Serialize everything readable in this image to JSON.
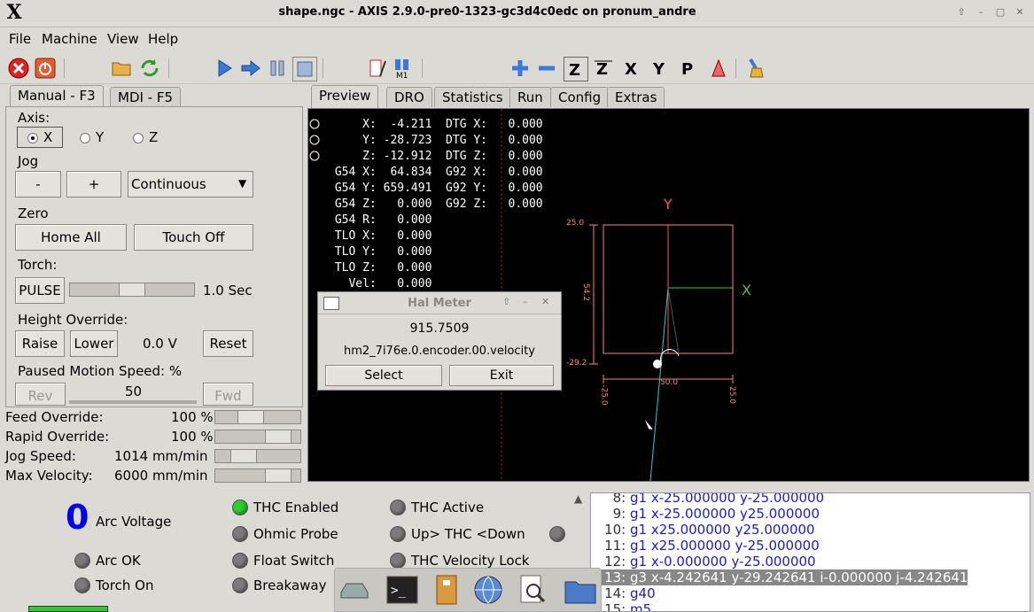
{
  "window": {
    "logo": "X",
    "title": "shape.ngc - AXIS 2.9.0-pre0-1323-gc3d4c0edc on pronum_andre",
    "controls": [
      "up-arrow-icon",
      "minimize-icon",
      "maximize-icon",
      "close-icon"
    ]
  },
  "menu": {
    "file": "File",
    "machine": "Machine",
    "view": "View",
    "help": "Help"
  },
  "toolbar": {
    "icons": [
      "estop-icon",
      "power-icon",
      "open-file-icon",
      "reload-icon",
      "run-icon",
      "step-icon",
      "pause-icon",
      "stop-icon",
      "block-delete-icon",
      "optional-stop-icon",
      "zoom-in-icon",
      "zoom-out-icon",
      "view-z-icon",
      "view-z2-icon",
      "view-x-icon",
      "view-y-icon",
      "view-p-icon",
      "rotate-view-icon",
      "clear-plot-icon"
    ]
  },
  "left_tabs": {
    "manual": "Manual - F3",
    "mdi": "MDI - F5"
  },
  "right_tabs": {
    "preview": "Preview",
    "dro": "DRO",
    "statistics": "Statistics",
    "run": "Run",
    "config": "Config",
    "extras": "Extras"
  },
  "manual": {
    "axis_label": "Axis:",
    "axes": [
      "X",
      "Y",
      "Z"
    ],
    "selected_axis": "X",
    "jog_label": "Jog",
    "jog_minus": "-",
    "jog_plus": "+",
    "jog_mode": "Continuous",
    "zero_label": "Zero",
    "home_all": "Home All",
    "touch_off": "Touch Off",
    "torch_label": "Torch:",
    "pulse": "PULSE",
    "pulse_time": "1.0 Sec",
    "pulse_level": 0.5,
    "height_override_label": "Height Override:",
    "raise": "Raise",
    "lower": "Lower",
    "height_value": "0.0 V",
    "reset": "Reset",
    "paused_speed_label": "Paused Motion Speed: %",
    "rev": "Rev",
    "paused_speed": "50",
    "fwd": "Fwd"
  },
  "overrides": {
    "feed_label": "Feed Override:",
    "feed_value": "100 %",
    "feed_level": 0.38,
    "rapid_label": "Rapid Override:",
    "rapid_value": "100 %",
    "rapid_level": 0.85,
    "jog_label": "Jog Speed:",
    "jog_value": "1014 mm/min",
    "jog_level": 0.25,
    "maxvel_label": "Max Velocity:",
    "maxvel_value": "6000 mm/min",
    "maxvel_level": 0.85
  },
  "dro": {
    "rows": [
      {
        "l": "     X:",
        "v": "  -4.211",
        "r": "DTG X:",
        "rv": "   0.000"
      },
      {
        "l": "     Y:",
        "v": " -28.723",
        "r": "DTG Y:",
        "rv": "   0.000"
      },
      {
        "l": "     Z:",
        "v": " -12.912",
        "r": "DTG Z:",
        "rv": "   0.000"
      },
      {
        "l": " G54 X:",
        "v": "  64.834",
        "r": "G92 X:",
        "rv": "   0.000"
      },
      {
        "l": " G54 Y:",
        "v": " 659.491",
        "r": "G92 Y:",
        "rv": "   0.000"
      },
      {
        "l": " G54 Z:",
        "v": "   0.000",
        "r": "G92 Z:",
        "rv": "   0.000"
      },
      {
        "l": " G54 R:",
        "v": "   0.000",
        "r": "",
        "rv": ""
      },
      {
        "l": " TLO X:",
        "v": "   0.000",
        "r": "",
        "rv": ""
      },
      {
        "l": " TLO Y:",
        "v": "   0.000",
        "r": "",
        "rv": ""
      },
      {
        "l": " TLO Z:",
        "v": "   0.000",
        "r": "",
        "rv": ""
      },
      {
        "l": "   Vel:",
        "v": "   0.000",
        "r": "",
        "rv": ""
      }
    ],
    "axis_y_label": "Y",
    "axis_x_label": "X",
    "dim_top": "25.0",
    "dim_left": "54.2",
    "dim_bottom_left": "-29.2",
    "dim_width": "50.0",
    "dim_x_min": "-25.0",
    "dim_x_max": "25.0"
  },
  "halmeter": {
    "title": "Hal Meter",
    "value": "915.7509",
    "pin": "hm2_7i76e.0.encoder.00.velocity",
    "select": "Select",
    "exit": "Exit"
  },
  "thc": {
    "arc_voltage_value": "0",
    "arc_voltage_label": "Arc Voltage",
    "arc_ok": "Arc OK",
    "torch_on": "Torch On",
    "thc_enabled": "THC Enabled",
    "ohmic_probe": "Ohmic Probe",
    "float_switch": "Float Switch",
    "breakaway": "Breakaway",
    "thc_active": "THC Active",
    "up_down": "Up> THC <Down",
    "velocity_lock": "THC Velocity Lock"
  },
  "gcode": [
    {
      "n": "8:",
      "t": "g1 x-25.000000 y-25.000000"
    },
    {
      "n": "9:",
      "t": "g1 x-25.000000 y25.000000"
    },
    {
      "n": "10:",
      "t": "g1 x25.000000 y25.000000"
    },
    {
      "n": "11:",
      "t": "g1 x25.000000 y-25.000000"
    },
    {
      "n": "12:",
      "t": "g1 x-0.000000 y-25.000000"
    },
    {
      "n": "13:",
      "t": "g3 x-4.242641 y-29.242641 i-0.000000 j-4.242641"
    },
    {
      "n": "14:",
      "t": "g40"
    },
    {
      "n": "15:",
      "t": "m5"
    }
  ],
  "colors": {
    "green_led": "#2ecc2e",
    "gcode_blue": "#1a1adf",
    "arc_voltage": "#0000ee",
    "plot_outline": "#ff8080"
  },
  "dock": [
    "drive-icon",
    "terminal-icon",
    "archive-icon",
    "globe-icon",
    "search-doc-icon",
    "folder-icon"
  ]
}
